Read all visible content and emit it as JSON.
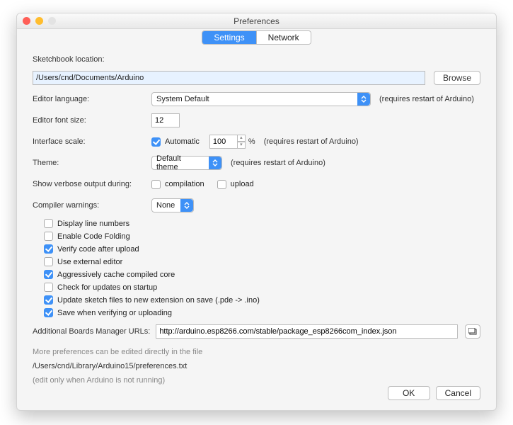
{
  "window": {
    "title": "Preferences"
  },
  "tabs": {
    "settings": "Settings",
    "network": "Network"
  },
  "sketchbook": {
    "label": "Sketchbook location:",
    "value": "/Users/cnd/Documents/Arduino",
    "browse": "Browse"
  },
  "editor_language": {
    "label": "Editor language:",
    "value": "System Default",
    "note": "(requires restart of Arduino)"
  },
  "font_size": {
    "label": "Editor font size:",
    "value": "12"
  },
  "interface_scale": {
    "label": "Interface scale:",
    "auto_label": "Automatic",
    "value": "100",
    "unit": "%",
    "note": "(requires restart of Arduino)"
  },
  "theme": {
    "label": "Theme:",
    "value": "Default theme",
    "note": "(requires restart of Arduino)"
  },
  "verbose": {
    "label": "Show verbose output during:",
    "compilation": "compilation",
    "upload": "upload"
  },
  "compiler_warnings": {
    "label": "Compiler warnings:",
    "value": "None"
  },
  "options": {
    "display_line_numbers": "Display line numbers",
    "enable_code_folding": "Enable Code Folding",
    "verify_after_upload": "Verify code after upload",
    "use_external_editor": "Use external editor",
    "aggressive_cache": "Aggressively cache compiled core",
    "check_updates": "Check for updates on startup",
    "update_sketch_ext": "Update sketch files to new extension on save (.pde -> .ino)",
    "save_on_verify": "Save when verifying or uploading"
  },
  "boards_url": {
    "label": "Additional Boards Manager URLs:",
    "value": "http://arduino.esp8266.com/stable/package_esp8266com_index.json"
  },
  "footnote": {
    "line1": "More preferences can be edited directly in the file",
    "path": "/Users/cnd/Library/Arduino15/preferences.txt",
    "line3": "(edit only when Arduino is not running)"
  },
  "buttons": {
    "ok": "OK",
    "cancel": "Cancel"
  }
}
